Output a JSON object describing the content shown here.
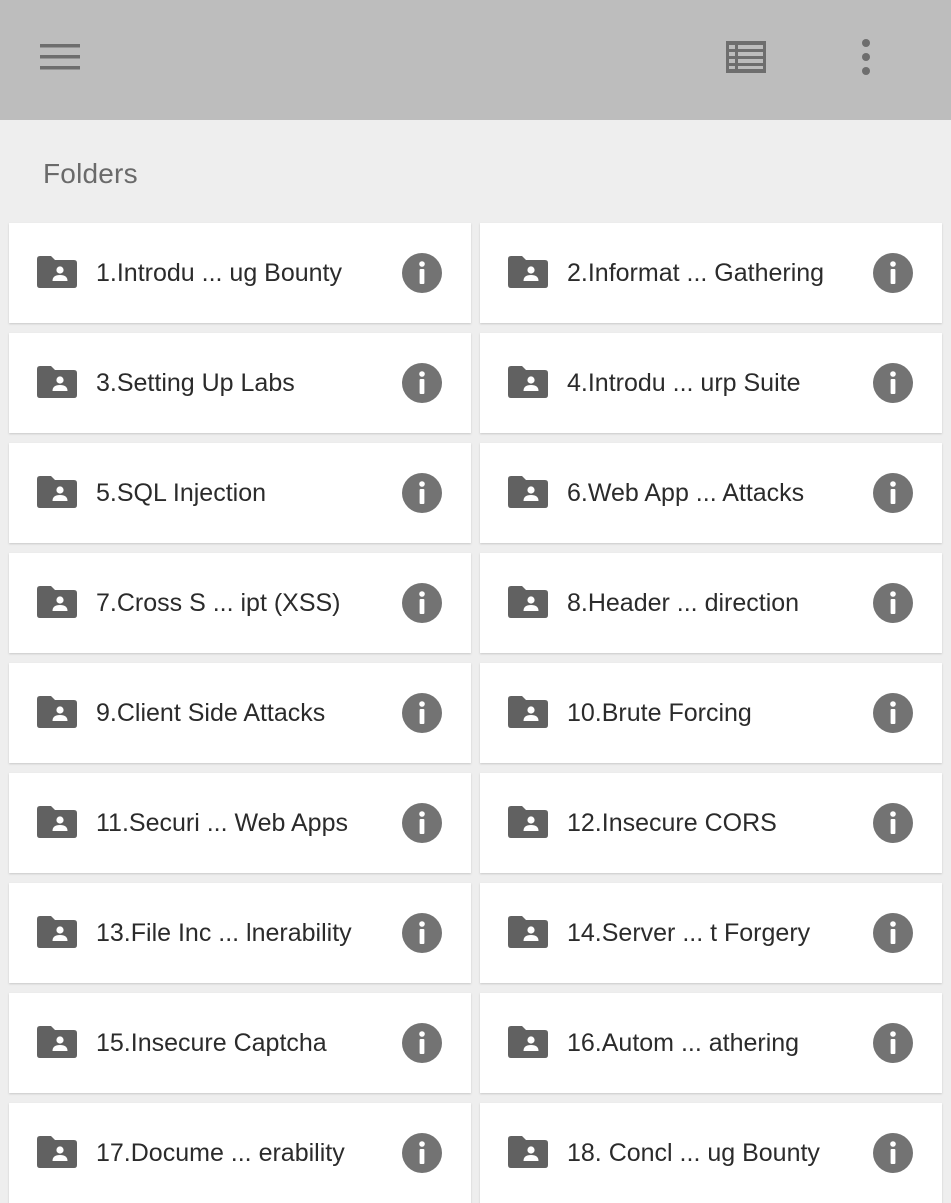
{
  "appbar": {
    "menu_icon": "hamburger-menu-icon",
    "view_icon": "list-view-icon",
    "more_icon": "more-vert-icon",
    "color": "#bdbdbd"
  },
  "section": {
    "title": "Folders"
  },
  "folders": [
    "1.Introdu ... ug Bounty",
    "2.Informat ... Gathering",
    "3.Setting Up Labs",
    "4.Introdu ... urp Suite",
    "5.SQL Injection",
    "6.Web App ... Attacks",
    "7.Cross S ... ipt (XSS)",
    "8.Header ... direction",
    "9.Client Side Attacks",
    "10.Brute Forcing",
    "11.Securi ... Web Apps",
    "12.Insecure CORS",
    "13.File Inc ... lnerability",
    "14.Server ... t Forgery",
    "15.Insecure Captcha",
    "16.Autom ... athering",
    "17.Docume ... erability",
    "18. Concl ... ug Bounty"
  ],
  "colors": {
    "icon": "#616161",
    "info": "#737373",
    "card": "#ffffff",
    "background": "#eeeeee"
  }
}
